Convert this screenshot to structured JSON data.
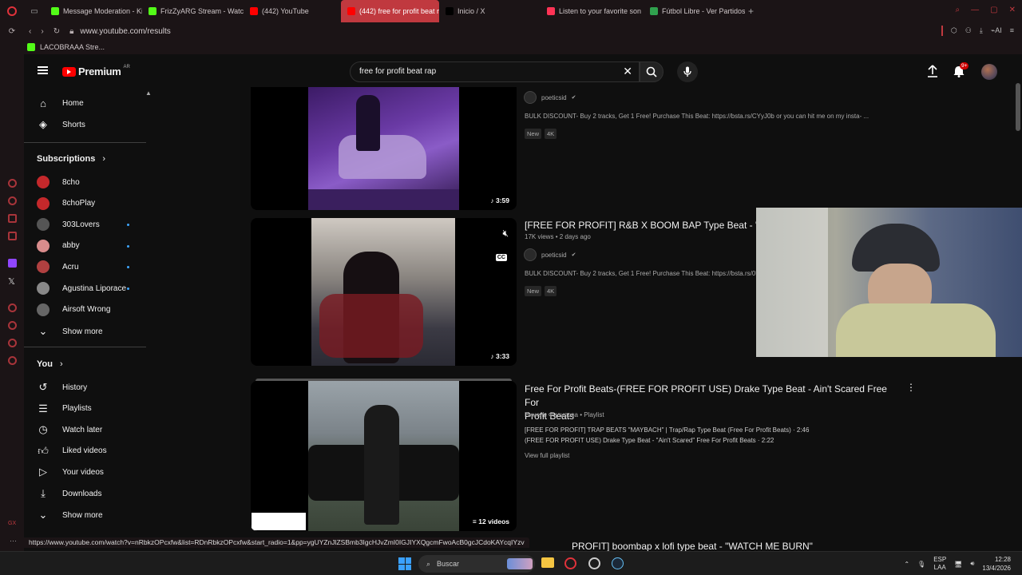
{
  "browser": {
    "tabs": [
      {
        "label": "Message Moderation - Ki",
        "color": "#53fc18"
      },
      {
        "label": "FrizZyARG Stream - Watc",
        "color": "#53fc18"
      },
      {
        "label": "(442) YouTube",
        "color": "#ff0000"
      },
      {
        "label": "(442) free for profit beat r",
        "color": "#ff0000",
        "active": true
      },
      {
        "label": "Inicio / X",
        "color": "#000000"
      },
      {
        "label": "Listen to your favorite son",
        "color": "#ff3355"
      },
      {
        "label": "Fútbol Libre - Ver Partidos",
        "color": "#30a14e"
      }
    ],
    "url": "www.youtube.com/results",
    "bookmark": "LACOBRAAA Stre...",
    "status_url": "https://www.youtube.com/watch?v=nRbkzOPcxfw&list=RDnRbkzOPcxfw&start_radio=1&pp=ygUYZnJlZSBmb3IgcHJvZmI0IGJIYXQgcmFwoAcB0gcJCdoKAYcqIYzv"
  },
  "yt": {
    "logo": "Premium",
    "region": "AR",
    "search_value": "free for profit beat rap",
    "notif_count": "9+",
    "sidebar": {
      "main": [
        {
          "label": "Home",
          "icon": "home-icon"
        },
        {
          "label": "Shorts",
          "icon": "shorts-icon"
        }
      ],
      "subs_title": "Subscriptions",
      "subs": [
        {
          "label": "8cho",
          "color": "#c4282b",
          "dot": false
        },
        {
          "label": "8choPlay",
          "color": "#c4282b",
          "dot": false
        },
        {
          "label": "303Lovers",
          "color": "#555555",
          "dot": true
        },
        {
          "label": "abby",
          "color": "#d98c8c",
          "dot": true
        },
        {
          "label": "Acru",
          "color": "#b04040",
          "dot": true
        },
        {
          "label": "Agustina Liporace",
          "color": "#888888",
          "dot": true
        },
        {
          "label": "Airsoft Wrong",
          "color": "#666666",
          "dot": false
        }
      ],
      "show_more": "Show more",
      "you_title": "You",
      "you": [
        {
          "label": "History",
          "icon": "history-icon"
        },
        {
          "label": "Playlists",
          "icon": "playlists-icon"
        },
        {
          "label": "Watch later",
          "icon": "watch-later-icon"
        },
        {
          "label": "Liked videos",
          "icon": "like-icon"
        },
        {
          "label": "Your videos",
          "icon": "your-videos-icon"
        },
        {
          "label": "Downloads",
          "icon": "download-icon"
        }
      ],
      "show_more2": "Show more"
    },
    "results": [
      {
        "channel": "poeticsid",
        "desc": "BULK DISCOUNT- Buy 2 tracks, Get 1 Free! Purchase This Beat: https://bsta.rs/CYyJ0b or you can hit me on my insta- ...",
        "chips": [
          "New",
          "4K"
        ],
        "duration": "3:59"
      },
      {
        "title": "[FREE FOR PROFIT] R&B X BOOM BAP Type Beat - \"EXT",
        "views": "17K views",
        "age": "2 days ago",
        "channel": "poeticsid",
        "desc": "BULK DISCOUNT- Buy 2 tracks, Get 1 Free! Purchase This Beat: https://bsta.rs/0Ul",
        "chips": [
          "New",
          "4K"
        ],
        "duration": "3:33",
        "cc": "CC"
      },
      {
        "title_line1": "Free For Profit Beats-(FREE FOR PROFIT USE) Drake Type Beat - Ain't Scared Free For",
        "title_line2": "Profit Beats",
        "channel": "Нинель Филипова",
        "type": "Playlist",
        "item1": "[FREE FOR PROFIT] TRAP BEATS \"MAYBACH\" | Trap/Rap Type Beat (Free For Profit Beats) · 2:46",
        "item2": "(FREE FOR PROFIT USE) Drake Type Beat - \"Ain't Scared\" Free For Profit Beats · 2:22",
        "view_full": "View full playlist",
        "videos": "12 videos"
      },
      {
        "title": "PROFIT] boombap x lofi type beat - \"WATCH ME BURN\""
      }
    ]
  },
  "taskbar": {
    "search": "Buscar",
    "lang1": "ESP",
    "lang2": "LAA",
    "time": "12:28",
    "date": "13/4/2026"
  }
}
